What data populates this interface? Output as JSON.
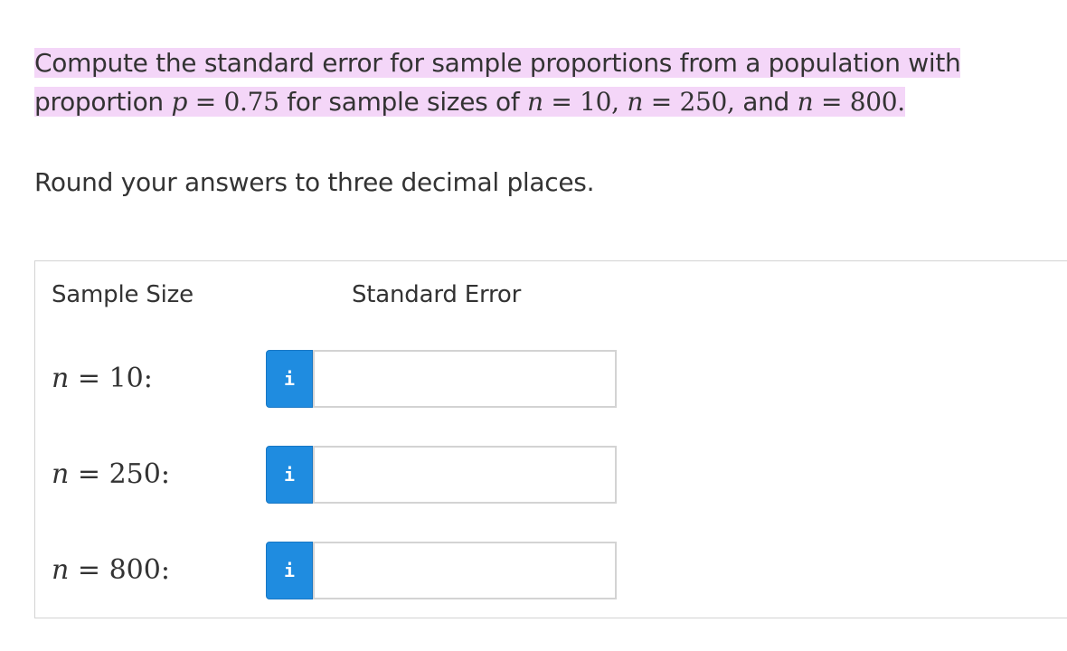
{
  "question": {
    "text1": "Compute the standard error for sample proportions from a population with proportion ",
    "p_var": "p",
    "eq": "=",
    "p_value": "0.75",
    "text2": " for sample sizes of ",
    "n_var": "n",
    "n1_value": "10,",
    "n2_value": "250,",
    "text3": " and ",
    "n3_value": "800.",
    "highlight_color": "#f4d6f8"
  },
  "instruction": "Round your answers to three decimal places.",
  "table": {
    "header_size": "Sample Size",
    "header_error": "Standard Error",
    "rows": [
      {
        "var": "n",
        "eq": "=",
        "value": "10:",
        "info_label": "i",
        "answer": "",
        "placeholder": ""
      },
      {
        "var": "n",
        "eq": "=",
        "value": "250:",
        "info_label": "i",
        "answer": "",
        "placeholder": ""
      },
      {
        "var": "n",
        "eq": "=",
        "value": "800:",
        "info_label": "i",
        "answer": "",
        "placeholder": ""
      }
    ]
  },
  "colors": {
    "info_button": "#1f8ce0",
    "border": "#d3d3d3",
    "text": "#333333"
  }
}
